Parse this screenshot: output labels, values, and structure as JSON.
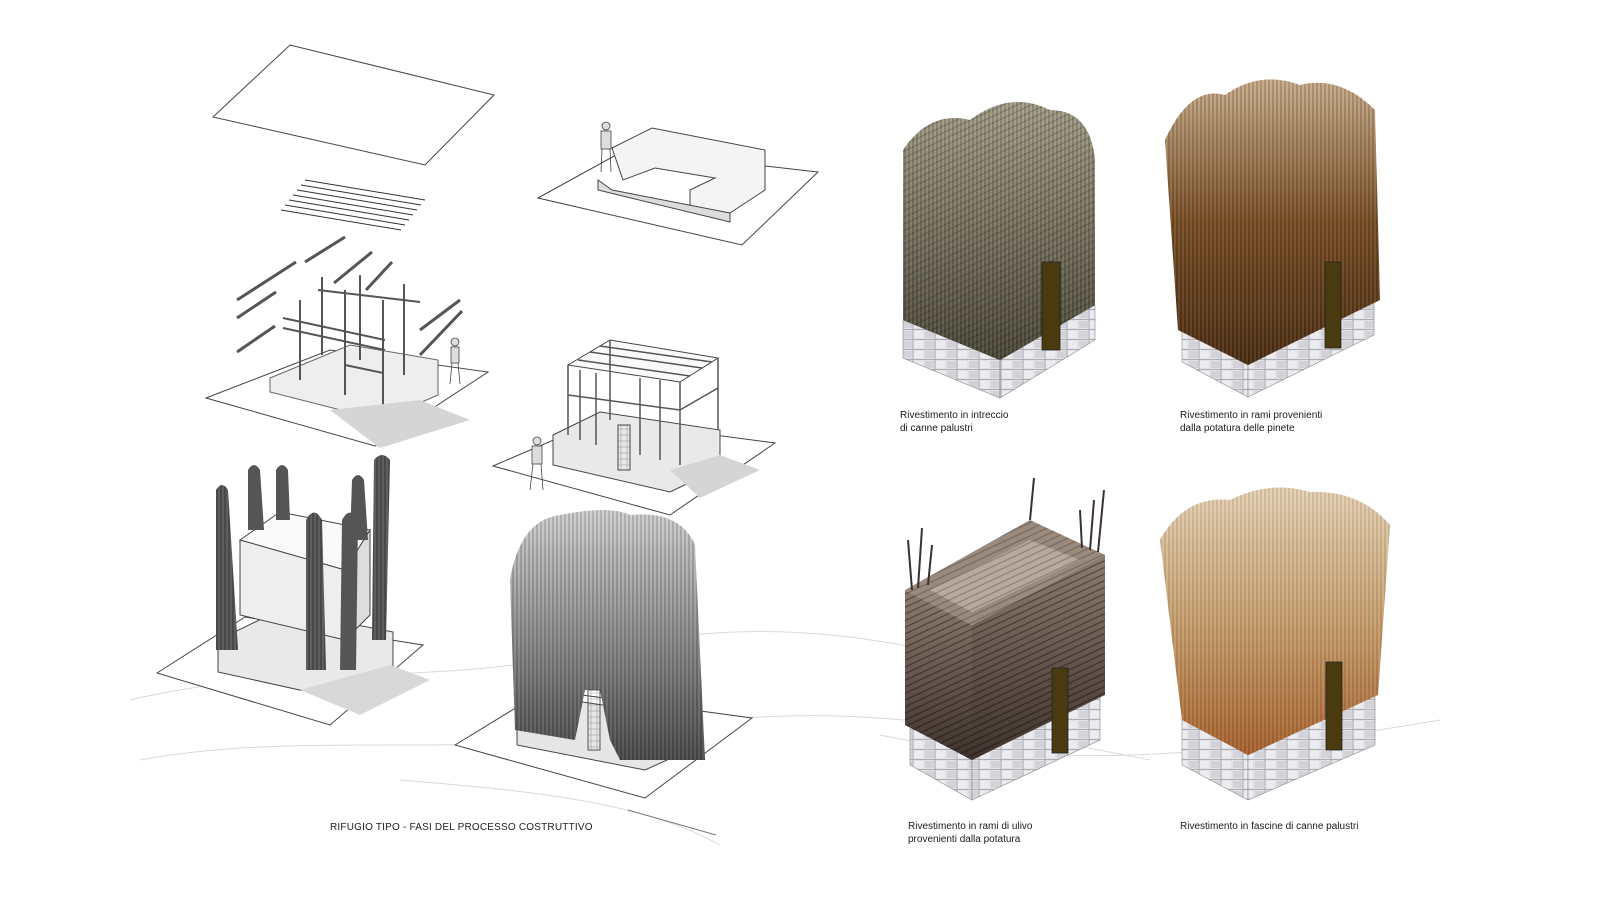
{
  "main_caption": "RIFUGIO TIPO - FASI DEL PROCESSO COSTRUTTIVO",
  "variants": [
    {
      "lines": [
        "Rivestimento in intreccio",
        "di canne palustri"
      ]
    },
    {
      "lines": [
        "Rivestimento in rami provenienti",
        "dalla potatura delle pinete"
      ]
    },
    {
      "lines": [
        "Rivestimento in rami di ulivo",
        "provenienti dalla potatura"
      ]
    },
    {
      "lines": [
        "Rivestimento in fascine di canne palustri"
      ]
    }
  ],
  "colors": {
    "line": "#555555",
    "door": "#4a3a10",
    "stone": "#d9d9de",
    "reed_weave": "#6e6a55",
    "pine_branches": "#7a4f26",
    "olive_branches": "#5a4a42",
    "reed_bundles": "#b5895a"
  }
}
